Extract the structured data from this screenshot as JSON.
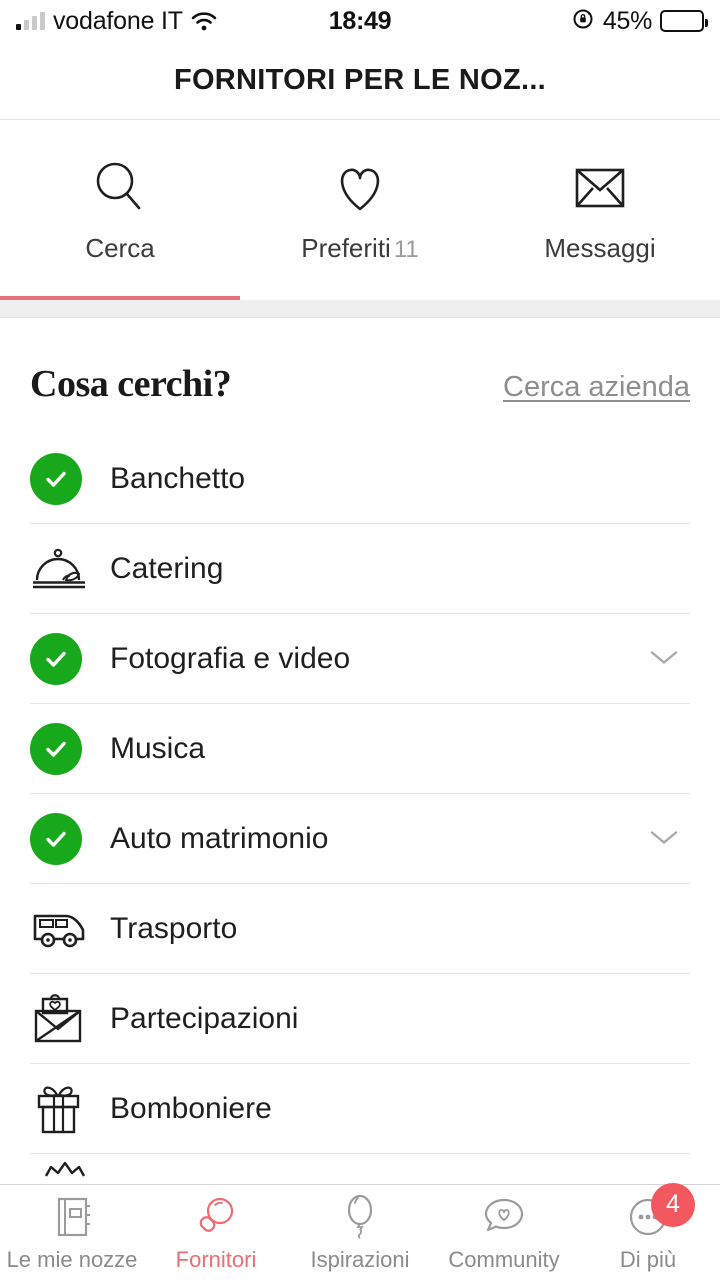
{
  "status_bar": {
    "carrier": "vodafone IT",
    "time": "18:49",
    "battery_percent": "45%",
    "battery_level": 45,
    "signal_icon": "signal-bars-icon",
    "wifi_icon": "wifi-icon",
    "rotation_lock_icon": "rotation-lock-icon",
    "battery_icon": "battery-icon"
  },
  "header": {
    "title": "FORNITORI PER LE NOZ..."
  },
  "top_tabs": {
    "active_index": 0,
    "items": [
      {
        "label": "Cerca",
        "icon": "search-icon",
        "count": ""
      },
      {
        "label": "Preferiti",
        "icon": "heart-icon",
        "count": "11"
      },
      {
        "label": "Messaggi",
        "icon": "envelope-icon",
        "count": ""
      }
    ]
  },
  "section": {
    "title": "Cosa cerchi?",
    "link": "Cerca azienda"
  },
  "categories": [
    {
      "label": "Banchetto",
      "icon": "check-circle-icon",
      "checked": true,
      "expandable": false
    },
    {
      "label": "Catering",
      "icon": "cloche-icon",
      "checked": false,
      "expandable": false
    },
    {
      "label": "Fotografia e video",
      "icon": "check-circle-icon",
      "checked": true,
      "expandable": true
    },
    {
      "label": "Musica",
      "icon": "check-circle-icon",
      "checked": true,
      "expandable": false
    },
    {
      "label": "Auto matrimonio",
      "icon": "check-circle-icon",
      "checked": true,
      "expandable": true
    },
    {
      "label": "Trasporto",
      "icon": "van-icon",
      "checked": false,
      "expandable": false
    },
    {
      "label": "Partecipazioni",
      "icon": "envelope-heart-icon",
      "checked": false,
      "expandable": false
    },
    {
      "label": "Bomboniere",
      "icon": "gift-icon",
      "checked": false,
      "expandable": false
    }
  ],
  "bottom_nav": {
    "active_index": 1,
    "items": [
      {
        "label": "Le mie nozze",
        "icon": "notebook-icon",
        "badge": ""
      },
      {
        "label": "Fornitori",
        "icon": "search-icon",
        "badge": ""
      },
      {
        "label": "Ispirazioni",
        "icon": "balloon-icon",
        "badge": ""
      },
      {
        "label": "Community",
        "icon": "chat-heart-icon",
        "badge": ""
      },
      {
        "label": "Di più",
        "icon": "more-dots-icon",
        "badge": "4"
      }
    ]
  },
  "colors": {
    "accent_red": "#ef6b73",
    "badge_red": "#f2585e",
    "check_green": "#18a81b",
    "underline_red": "#e8707a"
  }
}
